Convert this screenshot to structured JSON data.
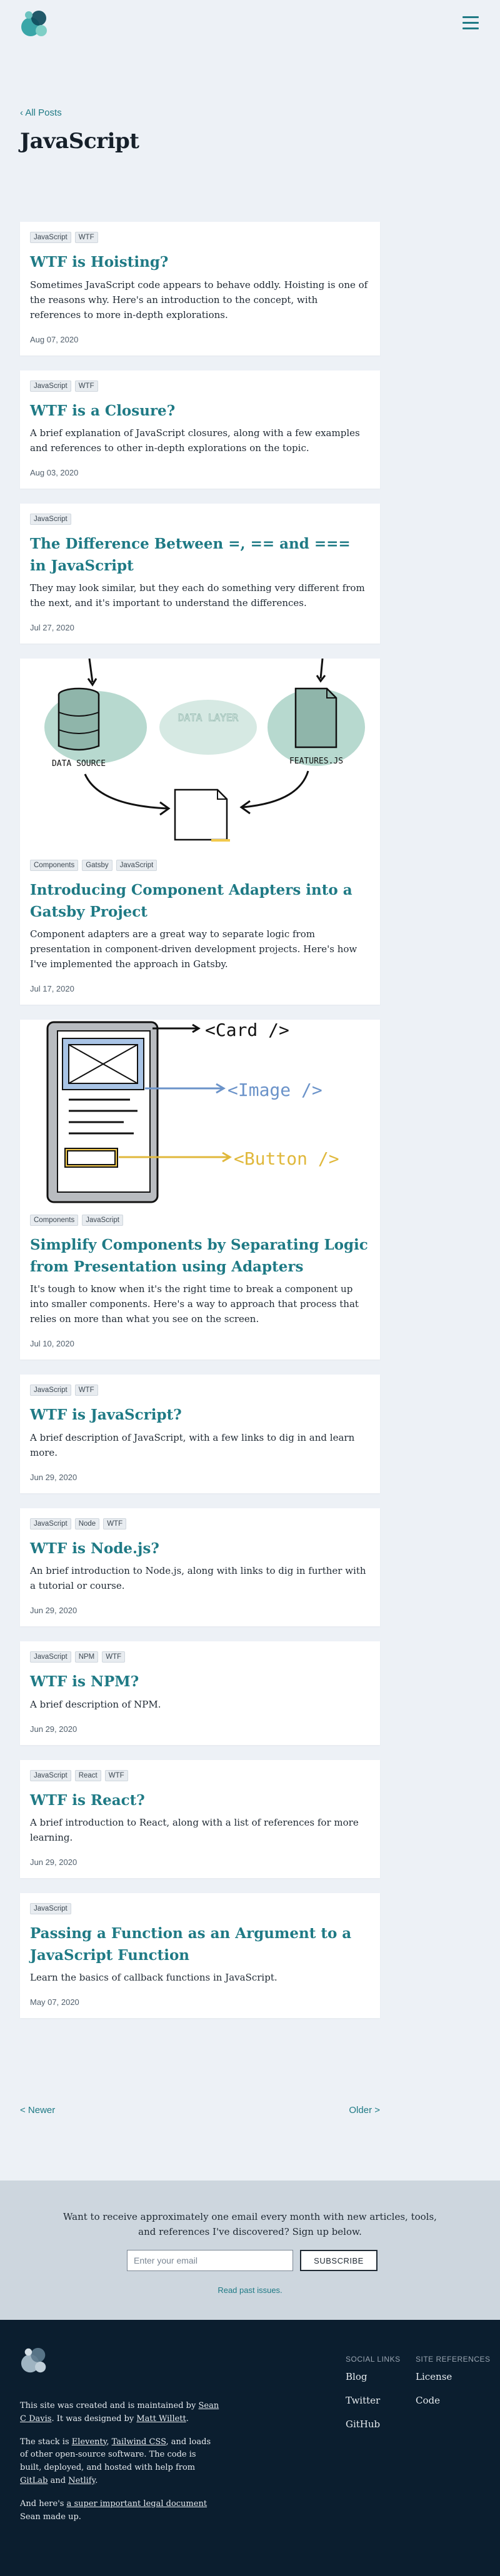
{
  "header": {
    "menu_label": ""
  },
  "breadcrumb": {
    "label": "All Posts"
  },
  "page_title": "JavaScript",
  "posts": [
    {
      "tags": [
        "JavaScript",
        "WTF"
      ],
      "title": "WTF is Hoisting?",
      "description": "Sometimes JavaScript code appears to behave oddly. Hoisting is one of the reasons why. Here's an introduction to the concept, with references to more in-depth explorations.",
      "date": "Aug 07, 2020"
    },
    {
      "tags": [
        "JavaScript",
        "WTF"
      ],
      "title": "WTF is a Closure?",
      "description": "A brief explanation of JavaScript closures, along with a few examples and references to other in-depth explorations on the topic.",
      "date": "Aug 03, 2020"
    },
    {
      "tags": [
        "JavaScript"
      ],
      "title": "The Difference Between =, == and === in JavaScript",
      "description": "They may look similar, but they each do something very different from the next, and it's important to understand the differences.",
      "date": "Jul 27, 2020"
    },
    {
      "tags": [
        "Components",
        "Gatsby",
        "JavaScript"
      ],
      "title": "Introducing Component Adapters into a Gatsby Project",
      "description": "Component adapters are a great way to separate logic from presentation in component-driven development projects. Here's how I've implemented the approach in Gatsby.",
      "date": "Jul 17, 2020",
      "image": {
        "labels": [
          "DATA SOURCE",
          "DATA LAYER",
          "FEATURES.JS"
        ]
      }
    },
    {
      "tags": [
        "Components",
        "JavaScript"
      ],
      "title": "Simplify Components by Separating Logic from Presentation using Adapters",
      "description": "It's tough to know when it's the right time to break a component up into smaller components. Here's a way to approach that process that relies on more than what you see on the screen.",
      "date": "Jul 10, 2020",
      "image": {
        "labels": [
          "<Card />",
          "<Image />",
          "<Button />"
        ]
      }
    },
    {
      "tags": [
        "JavaScript",
        "WTF"
      ],
      "title": "WTF is JavaScript?",
      "description": "A brief description of JavaScript, with a few links to dig in and learn more.",
      "date": "Jun 29, 2020"
    },
    {
      "tags": [
        "JavaScript",
        "Node",
        "WTF"
      ],
      "title": "WTF is Node.js?",
      "description": "An brief introduction to Node.js, along with links to dig in further with a tutorial or course.",
      "date": "Jun 29, 2020"
    },
    {
      "tags": [
        "JavaScript",
        "NPM",
        "WTF"
      ],
      "title": "WTF is NPM?",
      "description": "A brief description of NPM.",
      "date": "Jun 29, 2020"
    },
    {
      "tags": [
        "JavaScript",
        "React",
        "WTF"
      ],
      "title": "WTF is React?",
      "description": "A brief introduction to React, along with a list of references for more learning.",
      "date": "Jun 29, 2020"
    },
    {
      "tags": [
        "JavaScript"
      ],
      "title": "Passing a Function as an Argument to a JavaScript Function",
      "description": "Learn the basics of callback functions in JavaScript.",
      "date": "May 07, 2020"
    }
  ],
  "pagination": {
    "newer": "< Newer",
    "older": "Older >"
  },
  "newsletter": {
    "text": "Want to receive approximately one email every month with new articles, tools, and references I've discovered? Sign up below.",
    "placeholder": "Enter your email",
    "button": "SUBSCRIBE",
    "past_issues": "Read past issues."
  },
  "footer": {
    "line1_pre": "This site was created and is maintained by ",
    "author": "Sean C Davis",
    "line1_mid": ". It was designed by ",
    "designer": "Matt Willett",
    "line1_post": ".",
    "line2_pre": "The stack is ",
    "eleventy": "Eleventy",
    "line2_sep": ", ",
    "tailwind": "Tailwind CSS",
    "line2_mid": ", and loads of other open-source software. The code is built, deployed, and hosted with help from ",
    "gitlab": "GitLab",
    "line2_and": " and ",
    "netlify": "Netlify",
    "line2_post": ".",
    "line3_pre": "And here's ",
    "legal": "a super important legal document",
    "line3_post": " Sean made up.",
    "social_heading": "SOCIAL LINKS",
    "social": [
      "Blog",
      "Twitter",
      "GitHub"
    ],
    "refs_heading": "SITE REFERENCES",
    "refs": [
      "License",
      "Code"
    ]
  },
  "colors": {
    "accent": "#1f7a85",
    "background": "#edf1f6",
    "footer": "#0b1e2f",
    "newsletter": "#cdd6de"
  }
}
